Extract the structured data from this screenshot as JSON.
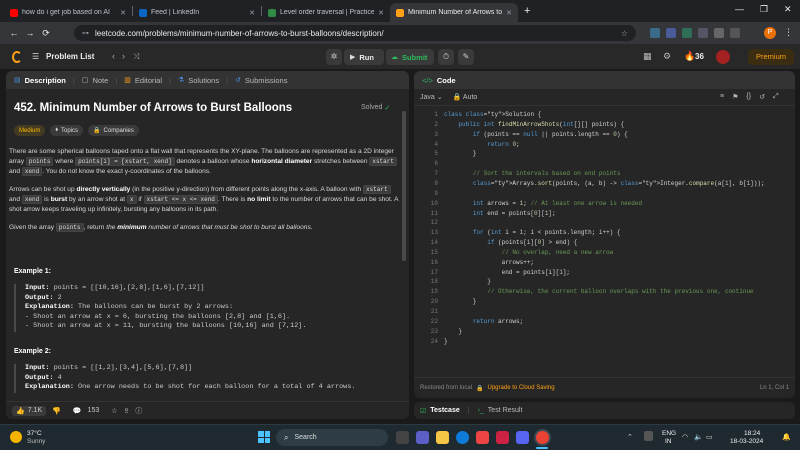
{
  "browser": {
    "tabs": [
      {
        "title": "how do i get job based on AI",
        "active": false
      },
      {
        "title": "Feed | LinkedIn",
        "active": false
      },
      {
        "title": "Level order traversal | Practice",
        "active": false
      },
      {
        "title": "Minimum Number of Arrows to",
        "active": true
      }
    ],
    "new_tab": "+",
    "url": "leetcode.com/problems/minimum-number-of-arrows-to-burst-balloons/description/",
    "profile_initial": "P"
  },
  "nav": {
    "problem_list": "Problem List",
    "run": "Run",
    "submit": "Submit",
    "streak": "36",
    "premium": "Premium"
  },
  "left_tabs": {
    "description": "Description",
    "note": "Note",
    "editorial": "Editorial",
    "solutions": "Solutions",
    "submissions": "Submissions"
  },
  "problem": {
    "title": "452. Minimum Number of Arrows to Burst Balloons",
    "status": "Solved",
    "difficulty": "Medium",
    "topics": "Topics",
    "companies": "Companies",
    "p1_a": "There are some spherical balloons taped onto a flat wall that represents the XY-plane. The balloons are represented as a 2D integer array ",
    "p1_code1": "points",
    "p1_b": " where ",
    "p1_code2": "points[i] = [xstart, xend]",
    "p1_c": " denotes a balloon whose ",
    "p1_bold": "horizontal diameter",
    "p1_d": " stretches between ",
    "p1_code3": "xstart",
    "p1_e": " and ",
    "p1_code4": "xend",
    "p1_f": ". You do not know the exact y-coordinates of the balloons.",
    "p2_a": "Arrows can be shot up ",
    "p2_bold1": "directly vertically",
    "p2_b": " (in the positive y-direction) from different points along the x-axis. A balloon with ",
    "p2_code1": "xstart",
    "p2_c": " and ",
    "p2_code2": "xend",
    "p2_d": " is ",
    "p2_bold2": "burst",
    "p2_e": " by an arrow shot at ",
    "p2_code3": "x",
    "p2_f": " if ",
    "p2_code4": "xstart <= x <= xend",
    "p2_g": ". There is ",
    "p2_bold3": "no limit",
    "p2_h": " to the number of arrows that can be shot. A shot arrow keeps traveling up infinitely, bursting any balloons in its path.",
    "p3_a": "Given the array ",
    "p3_code": "points",
    "p3_b": ", return ",
    "p3_em": "the ",
    "p3_bold": "minimum",
    "p3_c": " number of arrows that must be shot to burst all balloons",
    "p3_d": ".",
    "example1": {
      "title": "Example 1:",
      "input_label": "Input:",
      "input": " points = [[10,16],[2,8],[1,6],[7,12]]",
      "output_label": "Output:",
      "output": " 2",
      "expl_label": "Explanation:",
      "expl": [
        " The balloons can be burst by 2 arrows:",
        "- Shoot an arrow at x = 6, bursting the balloons [2,8] and [1,6].",
        "- Shoot an arrow at x = 11, bursting the balloons [10,16] and [7,12]."
      ]
    },
    "example2": {
      "title": "Example 2:",
      "input_label": "Input:",
      "input": " points = [[1,2],[3,4],[5,6],[7,8]]",
      "output_label": "Output:",
      "output": " 4",
      "expl_label": "Explanation:",
      "expl": [
        " One arrow needs to be shot for each balloon for a total of 4 arrows."
      ]
    }
  },
  "footer_left": {
    "likes": "7.1K",
    "comments": "153"
  },
  "code_panel": {
    "title": "Code",
    "language": "Java",
    "auto": "Auto",
    "footer_note": "Restored from local",
    "upgrade": "Upgrade to Cloud Saving",
    "cursor": "Ln 1, Col 1"
  },
  "code_lines": [
    "class Solution {",
    "    public int findMinArrowShots(int[][] points) {",
    "        if (points == null || points.length == 0) {",
    "            return 0;",
    "        }",
    "",
    "        // Sort the intervals based on end points",
    "        Arrays.sort(points, (a, b) -> Integer.compare(a[1], b[1]));",
    "",
    "        int arrows = 1; // At least one arrow is needed",
    "        int end = points[0][1];",
    "",
    "        for (int i = 1; i < points.length; i++) {",
    "            if (points[i][0] > end) {",
    "                // No overlap, need a new arrow",
    "                arrows++;",
    "                end = points[i][1];",
    "            }",
    "            // Otherwise, the current balloon overlaps with the previous one, continue",
    "        }",
    "",
    "        return arrows;",
    "    }",
    "}"
  ],
  "bottom_tabs": {
    "testcase": "Testcase",
    "test_result": "Test Result"
  },
  "taskbar": {
    "temp": "37°C",
    "weather": "Sunny",
    "search": "Search",
    "lang1": "ENG",
    "lang2": "IN",
    "time": "18:24",
    "date": "18-03-2024"
  }
}
